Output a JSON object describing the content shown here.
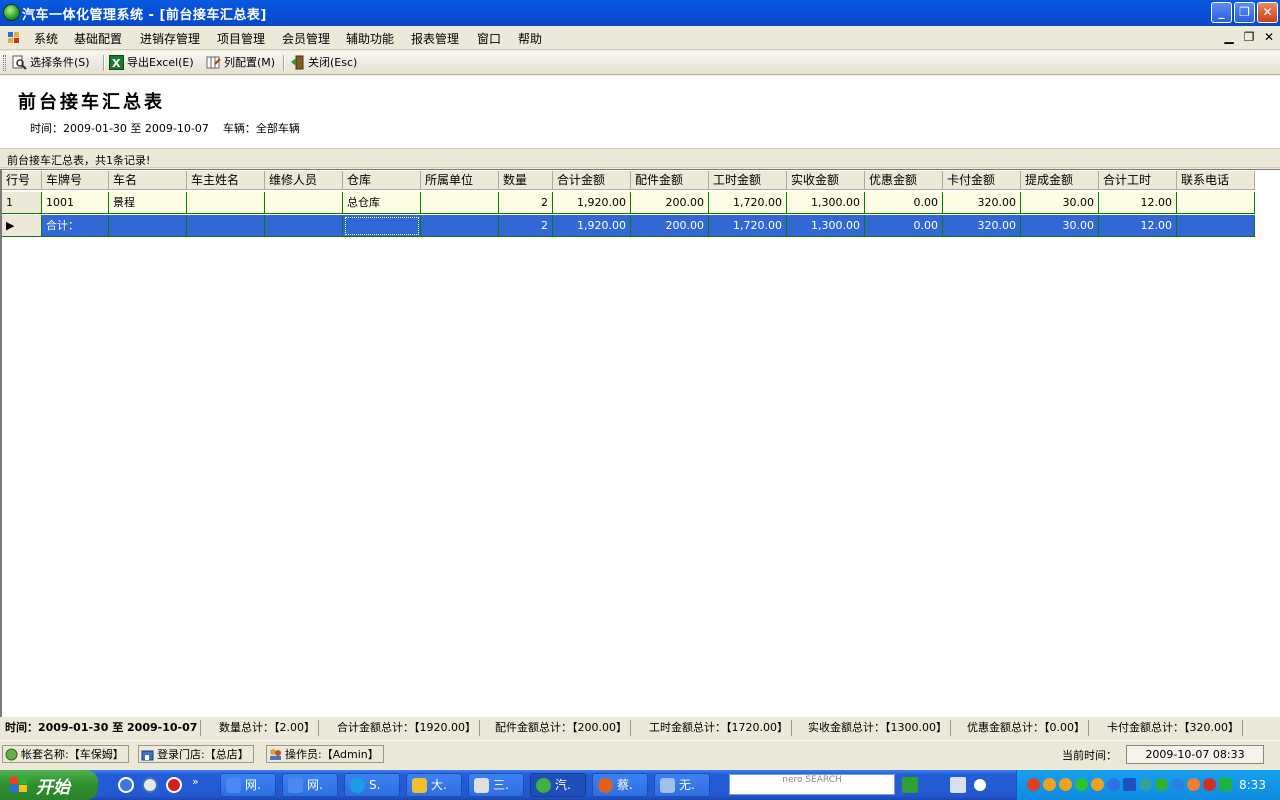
{
  "window": {
    "title": "汽车一体化管理系统 - [前台接车汇总表]",
    "buttons": [
      "minimize",
      "restore",
      "close"
    ]
  },
  "menu": {
    "items": [
      "系统",
      "基础配置",
      "进销存管理",
      "项目管理",
      "会员管理",
      "辅助功能",
      "报表管理",
      "窗口",
      "帮助"
    ]
  },
  "toolbar": {
    "select_condition": "选择条件(S)",
    "export_excel": "导出Excel(E)",
    "column_config": "列配置(M)",
    "close": "关闭(Esc)"
  },
  "report": {
    "title": "前台接车汇总表",
    "subtitle": "时间：2009-01-30 至 2009-10-07    车辆：全部车辆",
    "summary": "前台接车汇总表，共1条记录!"
  },
  "grid": {
    "columns": [
      "行号",
      "车牌号",
      "车名",
      "车主姓名",
      "维修人员",
      "仓库",
      "所属单位",
      "数量",
      "合计金额",
      "配件金额",
      "工时金额",
      "实收金额",
      "优惠金额",
      "卡付金额",
      "提成金额",
      "合计工时",
      "联系电话"
    ],
    "rows": [
      [
        "1",
        "1001",
        "景程",
        "",
        "",
        "总仓库",
        "",
        "2",
        "1,920.00",
        "200.00",
        "1,720.00",
        "1,300.00",
        "0.00",
        "320.00",
        "30.00",
        "12.00",
        ""
      ]
    ],
    "total_row": [
      "",
      "合计：",
      "",
      "",
      "",
      "",
      "",
      "2",
      "1,920.00",
      "200.00",
      "1,720.00",
      "1,300.00",
      "0.00",
      "320.00",
      "30.00",
      "12.00",
      ""
    ]
  },
  "status_totals": [
    "时间：2009-01-30 至 2009-10-07",
    "数量总计：【2.00】",
    "合计金额总计：【1920.00】",
    "配件金额总计：【200.00】",
    "工时金额总计：【1720.00】",
    "实收金额总计：【1300.00】",
    "优惠金额总计：【0.00】",
    "卡付金额总计：【320.00】"
  ],
  "status_info": {
    "account": "帐套名称:【车保姆】",
    "store": "登录门店:【总店】",
    "operator": "操作员:【Admin】",
    "current_time_label": "当前时间：",
    "current_time": "2009-10-07 08:33"
  },
  "taskbar": {
    "start": "开始",
    "tasks": [
      "网.",
      "网.",
      "S.",
      "大.",
      "三.",
      "汽.",
      "蔡.",
      "无."
    ],
    "nero": "nero SEARCH",
    "clock": "8:33"
  }
}
